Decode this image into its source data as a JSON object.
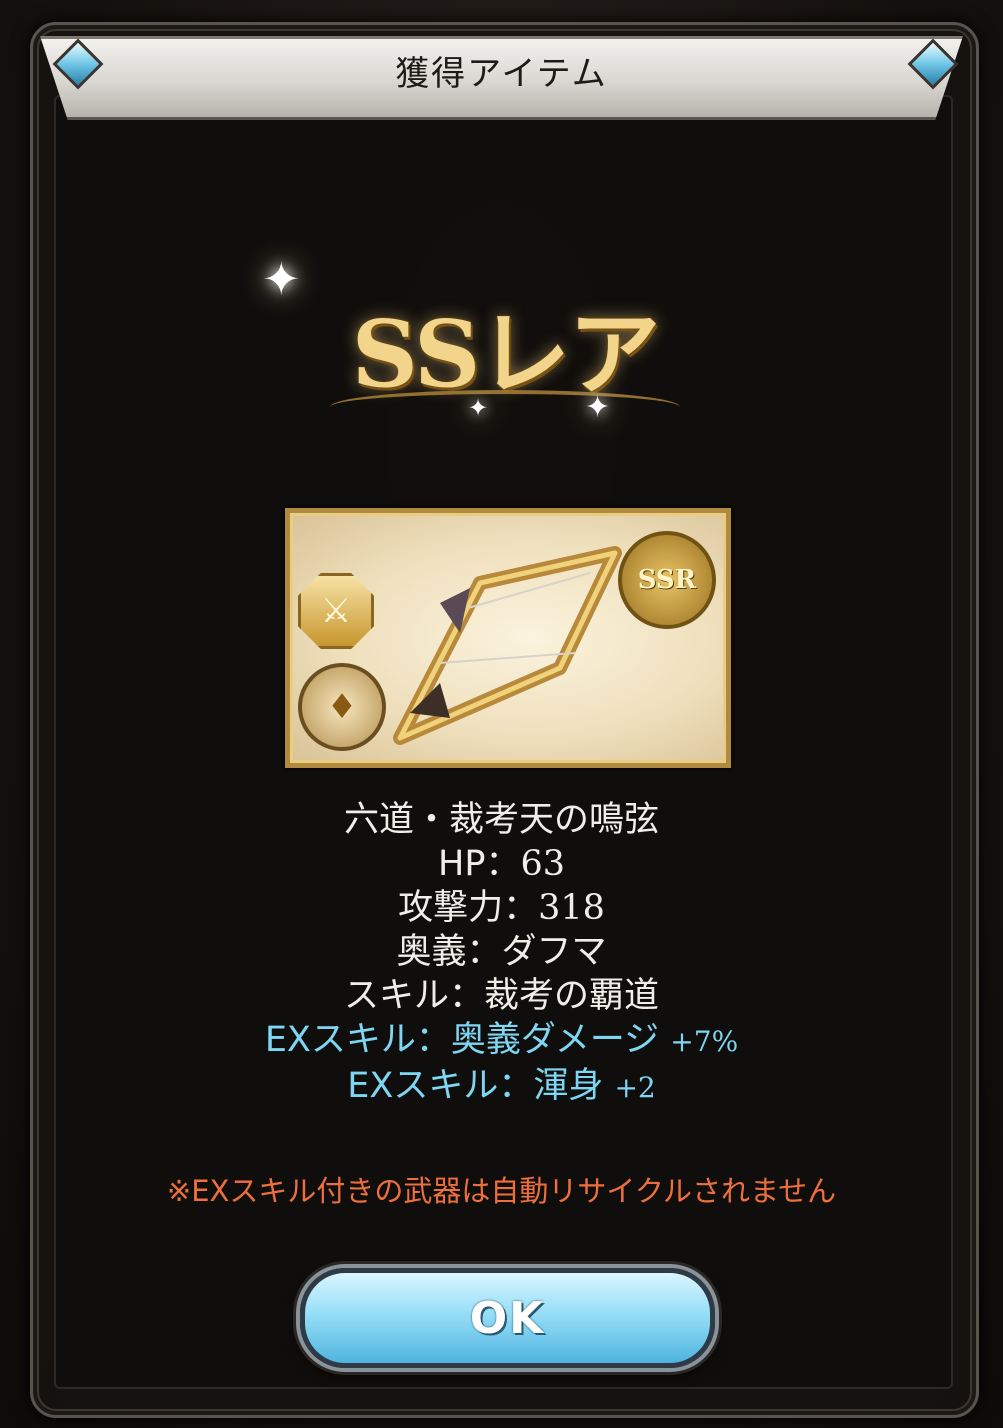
{
  "dialog": {
    "title": "獲得アイテム",
    "rarity": "SSレア"
  },
  "weapon": {
    "rarity_badge": "SSR",
    "name": "六道・裁考天の鳴弦",
    "hp_label": "HP：",
    "hp_value": "63",
    "atk_label": "攻撃力：",
    "atk_value": "318",
    "ougi": "奥義：ダフマ",
    "skill": "スキル：裁考の覇道",
    "ex_skill_1_label": "EXスキル：奥義ダメージ",
    "ex_skill_1_value": "+7%",
    "ex_skill_2_label": "EXスキル：渾身",
    "ex_skill_2_value": "+2"
  },
  "notice": "※EXスキル付きの武器は自動リサイクルされません",
  "ok_button": "OK",
  "colors": {
    "ex_skill": "#7ed6f2",
    "notice": "#ee6f3e",
    "gold": "#f2d48a"
  },
  "icons": [
    "gem-icon",
    "sword-type-icon",
    "element-icon",
    "sparkle-icon"
  ]
}
